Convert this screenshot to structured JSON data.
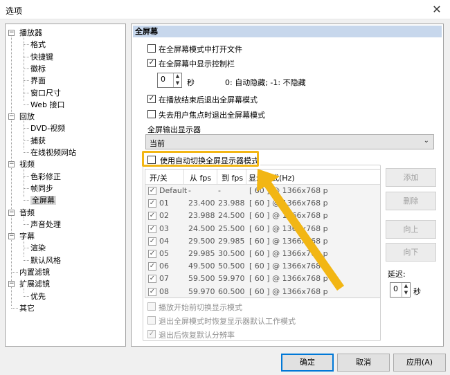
{
  "window": {
    "title": "选项",
    "close_glyph": "✕"
  },
  "tree": [
    {
      "label": "播放器",
      "expander": "−"
    },
    {
      "label": "格式"
    },
    {
      "label": "快捷键"
    },
    {
      "label": "徽标"
    },
    {
      "label": "界面"
    },
    {
      "label": "窗口尺寸"
    },
    {
      "label": "Web 接口"
    },
    {
      "label": "回放",
      "expander": "−"
    },
    {
      "label": "DVD-视频"
    },
    {
      "label": "捕获"
    },
    {
      "label": "在线视频网站"
    },
    {
      "label": "视频",
      "expander": "−"
    },
    {
      "label": "色彩修正"
    },
    {
      "label": "帧同步"
    },
    {
      "label": "全屏幕",
      "selected": true
    },
    {
      "label": "音频",
      "expander": "−"
    },
    {
      "label": "声音处理"
    },
    {
      "label": "字幕",
      "expander": "−"
    },
    {
      "label": "渲染"
    },
    {
      "label": "默认风格"
    },
    {
      "label": "内置滤镜"
    },
    {
      "label": "扩展滤镜",
      "expander": "−"
    },
    {
      "label": "优先"
    },
    {
      "label": "其它"
    }
  ],
  "panel": {
    "header": "全屏幕",
    "open_in_fullscreen": {
      "label": "在全屏幕模式中打开文件",
      "checked": false
    },
    "show_controls": {
      "label": "在全屏幕中显示控制栏",
      "checked": true
    },
    "hide_delay": {
      "value": "0",
      "unit": "秒",
      "hint": "0: 自动隐藏; -1: 不隐藏"
    },
    "exit_on_end": {
      "label": "在播放结束后退出全屏幕模式",
      "checked": true
    },
    "exit_on_focus_loss": {
      "label": "失去用户焦点时退出全屏幕模式",
      "checked": false
    },
    "output_monitor_label": "全屏输出显示器",
    "output_monitor_value": "当前",
    "auto_switch": {
      "label": "使用自动切换全屏显示器模式",
      "checked": false
    },
    "table": {
      "columns": [
        "开/关",
        "从 fps",
        "到 fps",
        "显示模式(Hz)"
      ],
      "rows": [
        {
          "name": "Default",
          "from": "-",
          "to": "-",
          "mode": "[ 60 ] @ 1366x768 p"
        },
        {
          "name": "01",
          "from": "23.400",
          "to": "23.988",
          "mode": "[ 60 ] @ 1366x768 p"
        },
        {
          "name": "02",
          "from": "23.988",
          "to": "24.500",
          "mode": "[ 60 ] @ 1366x768 p"
        },
        {
          "name": "03",
          "from": "24.500",
          "to": "25.500",
          "mode": "[ 60 ] @ 1366x768 p"
        },
        {
          "name": "04",
          "from": "29.500",
          "to": "29.985",
          "mode": "[ 60 ] @ 1366x768 p"
        },
        {
          "name": "05",
          "from": "29.985",
          "to": "30.500",
          "mode": "[ 60 ] @ 1366x768 p"
        },
        {
          "name": "06",
          "from": "49.500",
          "to": "50.500",
          "mode": "[ 60 ] @ 1366x768 p"
        },
        {
          "name": "07",
          "from": "59.500",
          "to": "59.970",
          "mode": "[ 60 ] @ 1366x768 p"
        },
        {
          "name": "08",
          "from": "59.970",
          "to": "60.500",
          "mode": "[ 60 ] @ 1366x768 p"
        }
      ]
    },
    "side_buttons": {
      "add": "添加",
      "delete": "删除",
      "up": "向上",
      "down": "向下"
    },
    "delay": {
      "label": "延迟:",
      "value": "0",
      "unit": "秒"
    },
    "switch_on_start": {
      "label": "播放开始前切换显示模式",
      "checked": false
    },
    "restore_on_exit": {
      "label": "退出全屏模式时恢复显示器默认工作模式",
      "checked": false
    },
    "restore_res_after_exit": {
      "label": "退出后恢复默认分辨率",
      "checked": true
    }
  },
  "footer": {
    "ok": "确定",
    "cancel": "取消",
    "apply": "应用(A)"
  },
  "colors": {
    "highlight": "#f2b614",
    "header_bg": "#c7d7ec",
    "default_button_border": "#0078d7"
  }
}
